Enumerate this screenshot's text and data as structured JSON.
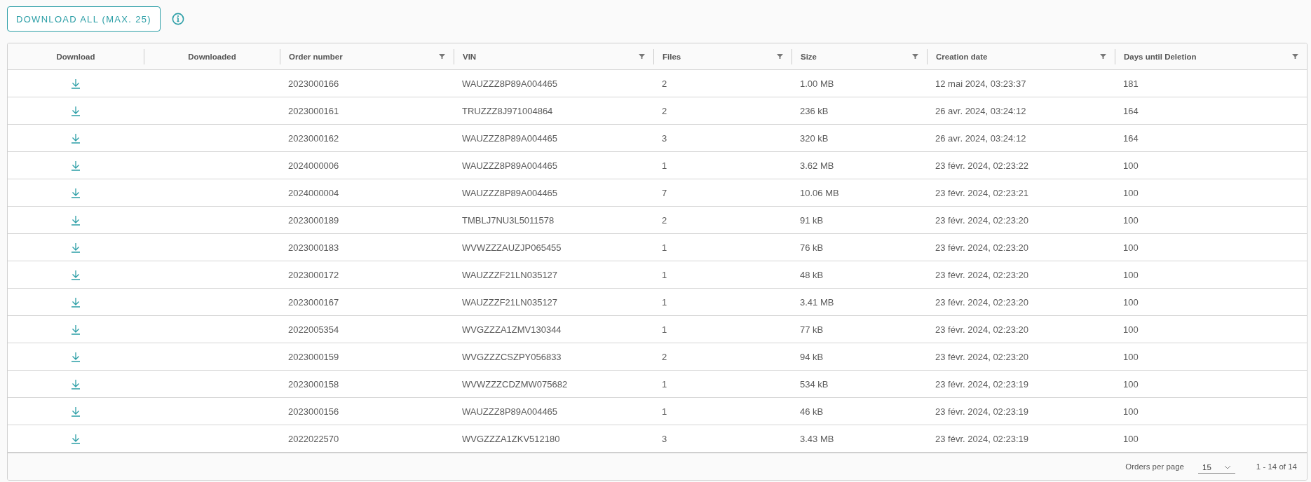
{
  "toolbar": {
    "download_all": "DOWNLOAD ALL (MAX. 25)"
  },
  "table": {
    "columns": [
      {
        "label": "Download",
        "filterable": false
      },
      {
        "label": "Downloaded",
        "filterable": false
      },
      {
        "label": "Order number",
        "filterable": true
      },
      {
        "label": "VIN",
        "filterable": true
      },
      {
        "label": "Files",
        "filterable": true
      },
      {
        "label": "Size",
        "filterable": true
      },
      {
        "label": "Creation date",
        "filterable": true
      },
      {
        "label": "Days until Deletion",
        "filterable": true
      }
    ],
    "rows": [
      {
        "order": "2023000166",
        "vin": "WAUZZZ8P89A004465",
        "files": "2",
        "size": "1.00 MB",
        "created": "12 mai 2024, 03:23:37",
        "days": "181"
      },
      {
        "order": "2023000161",
        "vin": "TRUZZZ8J971004864",
        "files": "2",
        "size": "236 kB",
        "created": "26 avr. 2024, 03:24:12",
        "days": "164"
      },
      {
        "order": "2023000162",
        "vin": "WAUZZZ8P89A004465",
        "files": "3",
        "size": "320 kB",
        "created": "26 avr. 2024, 03:24:12",
        "days": "164"
      },
      {
        "order": "2024000006",
        "vin": "WAUZZZ8P89A004465",
        "files": "1",
        "size": "3.62 MB",
        "created": "23 févr. 2024, 02:23:22",
        "days": "100"
      },
      {
        "order": "2024000004",
        "vin": "WAUZZZ8P89A004465",
        "files": "7",
        "size": "10.06 MB",
        "created": "23 févr. 2024, 02:23:21",
        "days": "100"
      },
      {
        "order": "2023000189",
        "vin": "TMBLJ7NU3L5011578",
        "files": "2",
        "size": "91 kB",
        "created": "23 févr. 2024, 02:23:20",
        "days": "100"
      },
      {
        "order": "2023000183",
        "vin": "WVWZZZAUZJP065455",
        "files": "1",
        "size": "76 kB",
        "created": "23 févr. 2024, 02:23:20",
        "days": "100"
      },
      {
        "order": "2023000172",
        "vin": "WAUZZZF21LN035127",
        "files": "1",
        "size": "48 kB",
        "created": "23 févr. 2024, 02:23:20",
        "days": "100"
      },
      {
        "order": "2023000167",
        "vin": "WAUZZZF21LN035127",
        "files": "1",
        "size": "3.41 MB",
        "created": "23 févr. 2024, 02:23:20",
        "days": "100"
      },
      {
        "order": "2022005354",
        "vin": "WVGZZZA1ZMV130344",
        "files": "1",
        "size": "77 kB",
        "created": "23 févr. 2024, 02:23:20",
        "days": "100"
      },
      {
        "order": "2023000159",
        "vin": "WVGZZZCSZPY056833",
        "files": "2",
        "size": "94 kB",
        "created": "23 févr. 2024, 02:23:20",
        "days": "100"
      },
      {
        "order": "2023000158",
        "vin": "WVWZZZCDZMW075682",
        "files": "1",
        "size": "534 kB",
        "created": "23 févr. 2024, 02:23:19",
        "days": "100"
      },
      {
        "order": "2023000156",
        "vin": "WAUZZZ8P89A004465",
        "files": "1",
        "size": "46 kB",
        "created": "23 févr. 2024, 02:23:19",
        "days": "100"
      },
      {
        "order": "2022022570",
        "vin": "WVGZZZA1ZKV512180",
        "files": "3",
        "size": "3.43 MB",
        "created": "23 févr. 2024, 02:23:19",
        "days": "100"
      }
    ]
  },
  "footer": {
    "per_page_label": "Orders per page",
    "per_page_value": "15",
    "range": "1 - 14 of 14"
  }
}
